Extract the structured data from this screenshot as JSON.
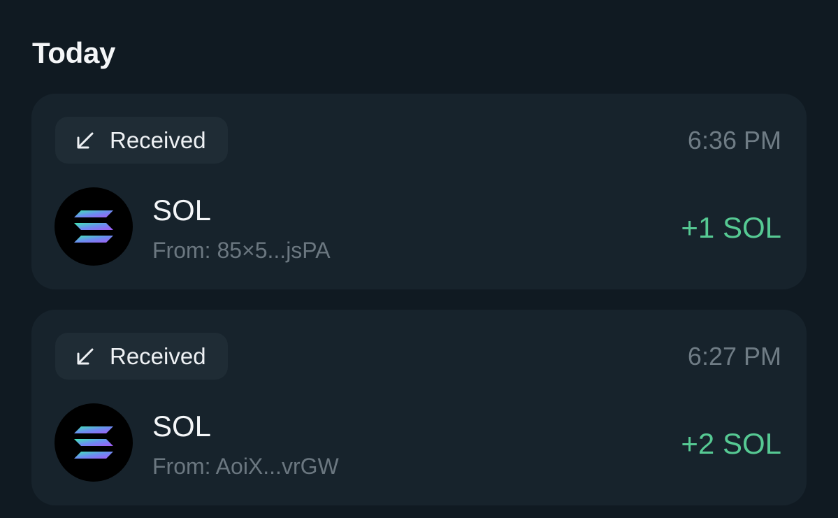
{
  "section": {
    "title": "Today"
  },
  "transactions": [
    {
      "type_label": "Received",
      "type_icon": "arrow-down-left-icon",
      "time": "6:36 PM",
      "token": "SOL",
      "token_icon": "solana-logo-icon",
      "from": "From: 85×5...jsPA",
      "amount": "+1 SOL"
    },
    {
      "type_label": "Received",
      "type_icon": "arrow-down-left-icon",
      "time": "6:27 PM",
      "token": "SOL",
      "token_icon": "solana-logo-icon",
      "from": "From: AoiX...vrGW",
      "amount": "+2 SOL"
    }
  ],
  "colors": {
    "background": "#101a22",
    "card": "#17232c",
    "badge": "#1f2c35",
    "amount_positive": "#56c993",
    "muted_text": "#6f7c85"
  }
}
